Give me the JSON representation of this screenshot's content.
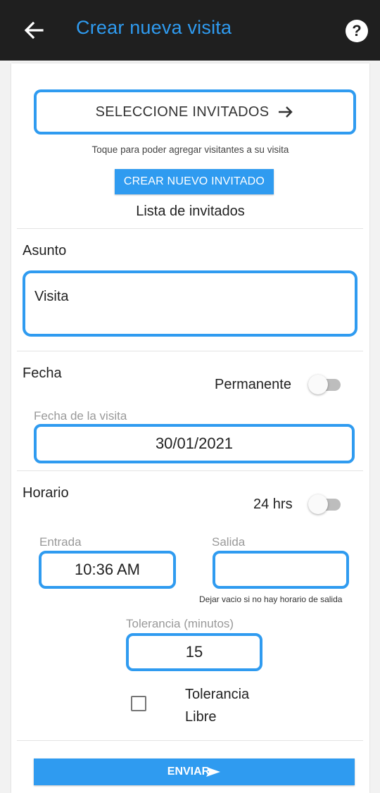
{
  "header": {
    "title": "Crear nueva visita",
    "help_label": "?"
  },
  "guests": {
    "select_label": "SELECCIONE INVITADOS",
    "hint": "Toque para poder agregar visitantes a su visita",
    "new_guest_label": "CREAR NUEVO INVITADO",
    "list_title": "Lista de invitados"
  },
  "subject": {
    "label": "Asunto",
    "value": "Visita"
  },
  "date": {
    "label": "Fecha",
    "permanent_label": "Permanente",
    "permanent_on": false,
    "field_label": "Fecha de la visita",
    "value": "30/01/2021"
  },
  "schedule": {
    "label": "Horario",
    "allday_label": "24 hrs",
    "allday_on": false,
    "entry_label": "Entrada",
    "entry_value": "10:36 AM",
    "exit_label": "Salida",
    "exit_value": "",
    "exit_hint": "Dejar vacio si no hay horario de salida",
    "tolerance_label": "Tolerancia (minutos)",
    "tolerance_value": "15",
    "free_tolerance_label": "Tolerancia Libre",
    "free_tolerance_checked": false
  },
  "submit_label": "ENVIAR",
  "colors": {
    "accent": "#2f9bf0",
    "appbar": "#1f1f1f"
  }
}
